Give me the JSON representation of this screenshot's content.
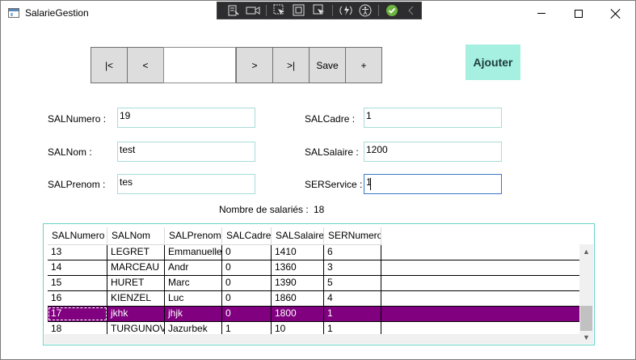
{
  "window": {
    "title": "SalarieGestion"
  },
  "debug_toolbar": {
    "icons": [
      "live-visual-tree-icon",
      "record-icon",
      "select-element-icon",
      "display-layout-adorners-icon",
      "track-focus-icon",
      "hot-reload-icon",
      "accessibility-icon",
      "check-icon",
      "collapse-icon"
    ]
  },
  "nav": {
    "first_label": "|<",
    "prev_label": "<",
    "position_value": "",
    "next_label": ">",
    "last_label": ">|",
    "save_label": "Save",
    "new_label": "+"
  },
  "actions": {
    "add_label": "Ajouter"
  },
  "form": {
    "salnumero_label": "SALNumero :",
    "salnumero_value": "19",
    "salnom_label": "SALNom :",
    "salnom_value": "test",
    "salprenom_label": "SALPrenom :",
    "salprenom_value": "tes",
    "salcadre_label": "SALCadre :",
    "salcadre_value": "1",
    "salsalaire_label": "SALSalaire :",
    "salsalaire_value": "1200",
    "serservice_label": "SERService :",
    "serservice_value": "1"
  },
  "summary": {
    "count_label": "Nombre de salariés :",
    "count_value": "18"
  },
  "grid": {
    "columns": [
      "SALNumero",
      "SALNom",
      "SALPrenom",
      "SALCadre",
      "SALSalaire",
      "SERNumero"
    ],
    "rows": [
      [
        "13",
        "LEGRET",
        "Emmanuelle",
        "0",
        "1410",
        "6"
      ],
      [
        "14",
        "MARCEAU",
        "Andr",
        "0",
        "1360",
        "3"
      ],
      [
        "15",
        "HURET",
        "Marc",
        "0",
        "1390",
        "5"
      ],
      [
        "16",
        "KIENZEL",
        "Luc",
        "0",
        "1860",
        "4"
      ],
      [
        "17",
        "jkhk",
        "jhjk",
        "0",
        "1800",
        "1"
      ],
      [
        "18",
        "TURGUNOV",
        "Jazurbek",
        "1",
        "10",
        "1"
      ]
    ],
    "selected_row": "17",
    "selection_color": "#800080"
  },
  "colors": {
    "accent": "#a5f0e0",
    "field_border": "#a8dcd8",
    "grid_border": "#69d3c6"
  }
}
